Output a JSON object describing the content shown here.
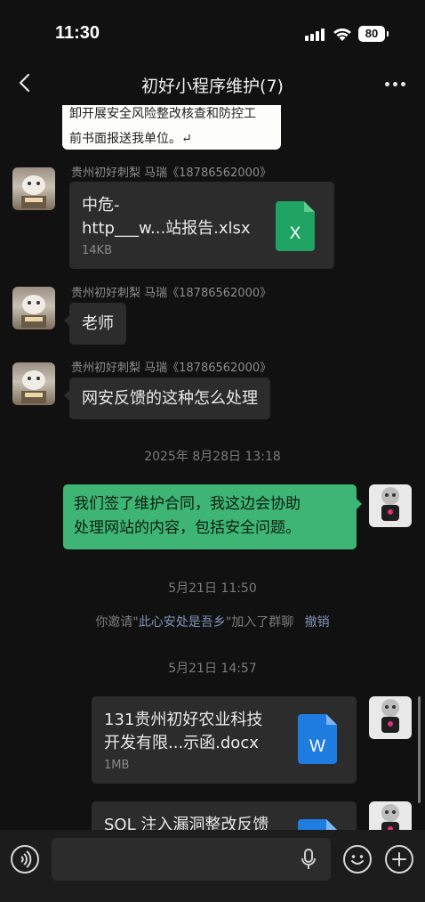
{
  "status_bar": {
    "time": "11:30",
    "battery": "80"
  },
  "header": {
    "title": "初好小程序维护(7)"
  },
  "doc_snippet": {
    "lines": [
      "卸开展安全风险整改核查和防控工",
      "前书面报送我单位。↵"
    ]
  },
  "messages": [
    {
      "sender": "贵州初好刺梨 马瑞《18786562000》",
      "file_name_line1": "中危-",
      "file_name_line2": "http___w...站报告.xlsx",
      "file_size": "14KB",
      "file_type": "X"
    },
    {
      "sender": "贵州初好刺梨 马瑞《18786562000》",
      "text": "老师"
    },
    {
      "sender": "贵州初好刺梨 马瑞《18786562000》",
      "text": "网安反馈的这种怎么处理"
    }
  ],
  "timestamps": [
    "2025年 8月28日 13:18",
    "5月21日 11:50",
    "5月21日 14:57"
  ],
  "outgoing": {
    "text_line1": "我们签了维护合同，我这边会协助",
    "text_line2": "处理网站的内容，包括安全问题。"
  },
  "system_message": {
    "prefix": "你邀请\"",
    "name": "此心安处是吾乡",
    "suffix": "\"加入了群聊",
    "action": "撤销"
  },
  "files_out": [
    {
      "name_line1": "131贵州初好农业科技",
      "name_line2": "开发有限...示函.docx",
      "size": "1MB",
      "type": "W"
    },
    {
      "name_line1": "SQL 注入漏洞整改反馈",
      "type": "W"
    }
  ],
  "colors": {
    "background": "#111111",
    "bubble_in": "#2c2c2c",
    "bubble_out": "#3eb575",
    "excel": "#1fa463",
    "word": "#1f7ce0",
    "link": "#7f93b8"
  },
  "icons": [
    "back-icon",
    "more-icon",
    "voice-icon",
    "mic-icon",
    "emoji-icon",
    "add-icon",
    "excel-file-icon",
    "word-file-icon"
  ]
}
